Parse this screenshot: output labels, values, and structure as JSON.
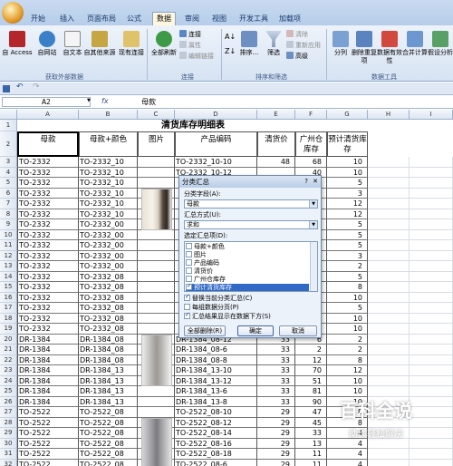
{
  "ribbon_tabs": [
    "开始",
    "插入",
    "页面布局",
    "公式",
    "数据",
    "审阅",
    "视图",
    "开发工具",
    "加载项"
  ],
  "active_tab_index": 4,
  "ribbon": {
    "ext": [
      "自 Access",
      "自网站",
      "自文本",
      "自其他来源",
      "现有连接"
    ],
    "ext_group": "获取外部数据",
    "refresh": "全部刷新",
    "conn_items": [
      "连接",
      "属性",
      "编辑链接"
    ],
    "conn_group": "连接",
    "sort": "排序...",
    "filter": "筛选",
    "filter_items": [
      "清除",
      "重新应用",
      "高级"
    ],
    "sort_group": "排序和筛选",
    "tools": [
      "分列",
      "删除重复项",
      "数据有效性",
      "合并计算",
      "假设分析"
    ],
    "tools_group": "数据工具"
  },
  "qat": {
    "undo": "↶",
    "redo": "↷"
  },
  "formula_bar": {
    "name_box": "A2",
    "fx": "fx",
    "value": "母款"
  },
  "columns": [
    "A",
    "B",
    "C",
    "D",
    "E",
    "F",
    "G",
    "H",
    "I"
  ],
  "sheet": {
    "title": "清货库存明细表",
    "headers": [
      "母款",
      "母款+颜色",
      "图片",
      "产品编码",
      "清货价",
      "广州仓库存",
      "预计清货库存"
    ],
    "rows": [
      [
        "TO-2332",
        "TO-2332_10",
        "",
        "TO-2332_10-10",
        "48",
        "68",
        "10"
      ],
      [
        "TO-2332",
        "TO-2332_10",
        "",
        "TO-2332_10-12",
        "",
        "40",
        "10"
      ],
      [
        "TO-2332",
        "TO-2332_10",
        "",
        "",
        "",
        "",
        "5"
      ],
      [
        "TO-2332",
        "TO-2332_10",
        "",
        "",
        "",
        "",
        "3"
      ],
      [
        "TO-2332",
        "TO-2332_10",
        "",
        "",
        "",
        "",
        "12"
      ],
      [
        "TO-2332",
        "TO-2332_10",
        "",
        "",
        "",
        "",
        "12"
      ],
      [
        "TO-2332",
        "TO-2332_00",
        "",
        "",
        "",
        "",
        "5"
      ],
      [
        "TO-2332",
        "TO-2332_00",
        "",
        "",
        "",
        "",
        "5"
      ],
      [
        "TO-2332",
        "TO-2332_00",
        "",
        "",
        "",
        "",
        "5"
      ],
      [
        "TO-2332",
        "TO-2332_00",
        "",
        "",
        "",
        "",
        "3"
      ],
      [
        "TO-2332",
        "TO-2332_00",
        "",
        "",
        "",
        "",
        "2"
      ],
      [
        "TO-2332",
        "TO-2332_08",
        "",
        "",
        "",
        "",
        "5"
      ],
      [
        "TO-2332",
        "TO-2332_08",
        "",
        "",
        "",
        "",
        "8"
      ],
      [
        "TO-2332",
        "TO-2332_08",
        "",
        "",
        "",
        "",
        "10"
      ],
      [
        "TO-2332",
        "TO-2332_08",
        "",
        "",
        "",
        "",
        "5"
      ],
      [
        "TO-2332",
        "TO-2332_08",
        "",
        "",
        "",
        "",
        "10"
      ],
      [
        "TO-2332",
        "TO-2332_08",
        "",
        "",
        "",
        "",
        "10"
      ],
      [
        "DR-1384",
        "DR-1384_08",
        "",
        "DR-1384_08-12",
        "33",
        "6",
        "2"
      ],
      [
        "DR-1384",
        "DR-1384_08",
        "",
        "DR-1384_08-6",
        "33",
        "2",
        "2"
      ],
      [
        "DR-1384",
        "DR-1384_08",
        "",
        "DR-1384_08-8",
        "33",
        "12",
        "8"
      ],
      [
        "DR-1384",
        "DR-1384_13",
        "",
        "DR-1384_13-10",
        "33",
        "70",
        "12"
      ],
      [
        "DR-1384",
        "DR-1384_13",
        "",
        "DR-1384_13-12",
        "33",
        "51",
        "10"
      ],
      [
        "DR-1384",
        "DR-1384_13",
        "",
        "DR-1384_13-6",
        "33",
        "81",
        "10"
      ],
      [
        "DR-1384",
        "DR-1384_13",
        "",
        "DR-1384_13-8",
        "33",
        "90",
        "10"
      ],
      [
        "TO-2522",
        "TO-2522_08",
        "",
        "TO-2522_08-10",
        "29",
        "47",
        "8"
      ],
      [
        "TO-2522",
        "TO-2522_08",
        "",
        "TO-2522_08-12",
        "29",
        "45",
        "8"
      ],
      [
        "TO-2522",
        "TO-2522_08",
        "",
        "TO-2522_08-14",
        "29",
        "33",
        "4"
      ],
      [
        "TO-2522",
        "TO-2522_08",
        "",
        "TO-2522_08-16",
        "29",
        "13",
        "4"
      ],
      [
        "TO-2522",
        "TO-2522_08",
        "",
        "TO-2522_08-18",
        "29",
        "11",
        "4"
      ],
      [
        "TO-2522",
        "TO-2522_08",
        "",
        "TO-2522_08-6",
        "29",
        "11",
        "4"
      ],
      [
        "TO-2522",
        "TO-2522_08",
        "",
        "TO-2522_08-8",
        "29",
        "",
        "10"
      ]
    ]
  },
  "dialog": {
    "title": "分类汇总",
    "help": "?",
    "close": "✕",
    "group_by_label": "分类字段(A):",
    "group_by_value": "母款",
    "function_label": "汇总方式(U):",
    "function_value": "求和",
    "subtotal_label": "选定汇总项(D):",
    "fields": [
      "母款+颜色",
      "图片",
      "产品编码",
      "清货价",
      "广州仓库存",
      "预计清货库存"
    ],
    "fields_checked": [
      false,
      false,
      false,
      false,
      false,
      true
    ],
    "options": [
      "替换当前分类汇总(C)",
      "每组数据分页(P)",
      "汇总结果显示在数据下方(S)"
    ],
    "options_checked": [
      true,
      false,
      true
    ],
    "remove_all": "全部删除(R)",
    "ok": "确定",
    "cancel": "取消"
  },
  "watermark": {
    "title": "百科全说",
    "subtitle": "助你轻松解决"
  }
}
